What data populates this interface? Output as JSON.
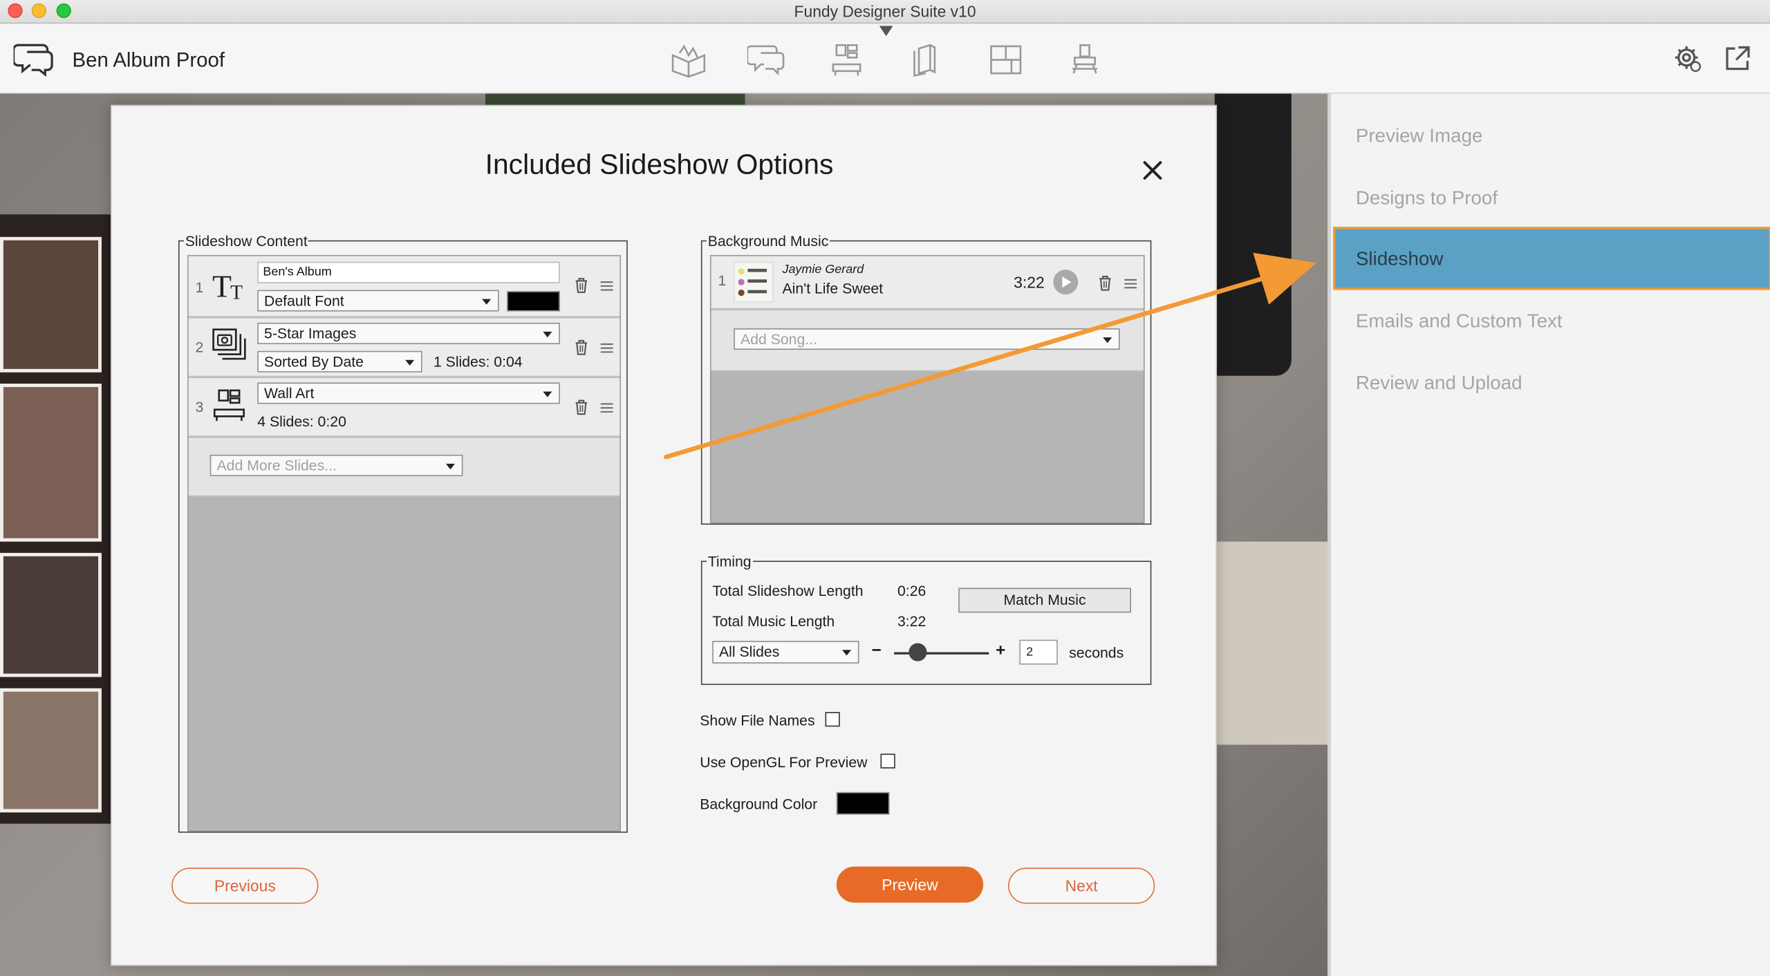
{
  "window": {
    "title": "Fundy Designer Suite v10"
  },
  "toolbar": {
    "album_title": "Ben Album Proof",
    "tools": [
      "album-icon",
      "proofing-icon",
      "wall-art-icon",
      "book-icon",
      "layout-icon",
      "stamp-icon"
    ],
    "right_tools": [
      "settings-icon",
      "external-link-icon"
    ]
  },
  "sidebar": {
    "items": [
      {
        "label": "Preview Image",
        "active": false
      },
      {
        "label": "Designs to Proof",
        "active": false
      },
      {
        "label": "Slideshow",
        "active": true
      },
      {
        "label": "Emails and Custom Text",
        "active": false
      },
      {
        "label": "Review and Upload",
        "active": false
      }
    ],
    "active_color": "#5ba1c6",
    "highlight_border": "#f39a34"
  },
  "dialog": {
    "title": "Included Slideshow Options",
    "slideshow_content": {
      "legend": "Slideshow Content",
      "rows": [
        {
          "num": "1",
          "text_value": "Ben's Album",
          "font": "Default Font",
          "color": "#000000"
        },
        {
          "num": "2",
          "source": "5-Star Images",
          "sort": "Sorted By Date",
          "info": "1 Slides: 0:04"
        },
        {
          "num": "3",
          "source": "Wall Art",
          "info": "4 Slides: 0:20"
        }
      ],
      "add_more_placeholder": "Add More Slides..."
    },
    "background_music": {
      "legend": "Background Music",
      "songs": [
        {
          "num": "1",
          "artist": "Jaymie Gerard",
          "title": "Ain't Life Sweet",
          "duration": "3:22"
        }
      ],
      "add_song_placeholder": "Add Song..."
    },
    "timing": {
      "legend": "Timing",
      "total_slideshow_label": "Total Slideshow Length",
      "total_slideshow_value": "0:26",
      "total_music_label": "Total Music Length",
      "total_music_value": "3:22",
      "match_music_label": "Match Music",
      "scope": "All Slides",
      "minus": "−",
      "plus": "+",
      "seconds_value": "2",
      "seconds_label": "seconds"
    },
    "options": {
      "show_file_names_label": "Show File Names",
      "show_file_names": false,
      "use_opengl_label": "Use OpenGL For Preview",
      "use_opengl": false,
      "background_color_label": "Background Color",
      "background_color": "#000000"
    },
    "buttons": {
      "previous": "Previous",
      "preview": "Preview",
      "next": "Next"
    }
  },
  "colors": {
    "accent": "#e86a27",
    "annotation_arrow": "#f39a34"
  }
}
